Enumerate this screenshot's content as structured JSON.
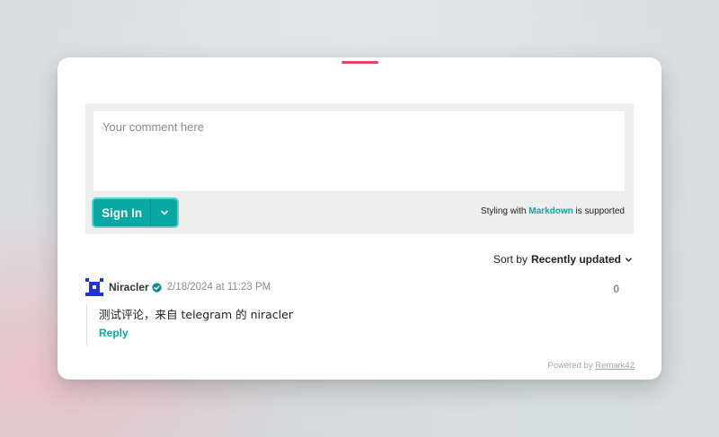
{
  "editor": {
    "placeholder": "Your comment here",
    "signin_label": "Sign In",
    "markdown_prefix": "Styling with ",
    "markdown_link": "Markdown",
    "markdown_suffix": " is supported"
  },
  "sort": {
    "label": "Sort by",
    "value": "Recently updated"
  },
  "comments": [
    {
      "username": "Niracler",
      "timestamp": "2/18/2024 at 11:23 PM",
      "score": "0",
      "text": "测试评论，来自 telegram 的 niracler",
      "reply_label": "Reply"
    }
  ],
  "footer": {
    "powered_prefix": "Powered by ",
    "powered_link": "Remark42"
  },
  "colors": {
    "accent": "#0aa8a3",
    "top_bar": "#e04b63",
    "avatar": "#2233dd",
    "verified": "#0a8f8a"
  },
  "icons": {
    "dropdown": "chevron-down-icon",
    "sort": "chevron-down-icon",
    "verified": "verified-badge-icon",
    "avatar": "pixel-identicon"
  }
}
